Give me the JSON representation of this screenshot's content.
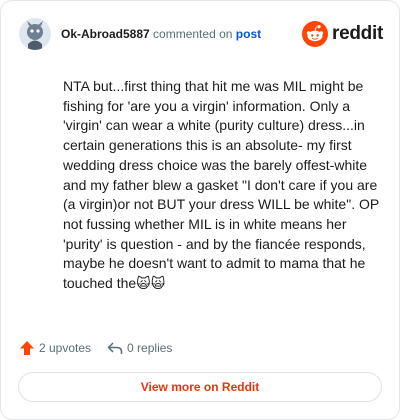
{
  "comment": {
    "username": "Ok-Abroad5887",
    "action_text": "commented on",
    "post_link": "post",
    "body": "NTA but...first thing that hit me was MIL might be fishing for 'are you a virgin' information. Only a 'virgin' can wear a white (purity culture) dress...in certain generations this is an absolute- my first wedding dress choice was the barely offest-white and my father blew a gasket \"I don't care if you are (a virgin)or not BUT your dress WILL be white\". OP not fussing whether MIL is in white means her 'purity' is question - and by the fiancée responds, maybe he doesn't want to admit to mama that he touched the🙀🙀",
    "upvotes_label": "2 upvotes",
    "replies_label": "0 replies"
  },
  "brand": {
    "name": "reddit",
    "color": "#ff4500"
  },
  "view_more_label": "View more on Reddit",
  "colors": {
    "accent": "#ff4500",
    "link": "#0b57d0",
    "view_more": "#e3360e",
    "muted": "#576f76"
  }
}
